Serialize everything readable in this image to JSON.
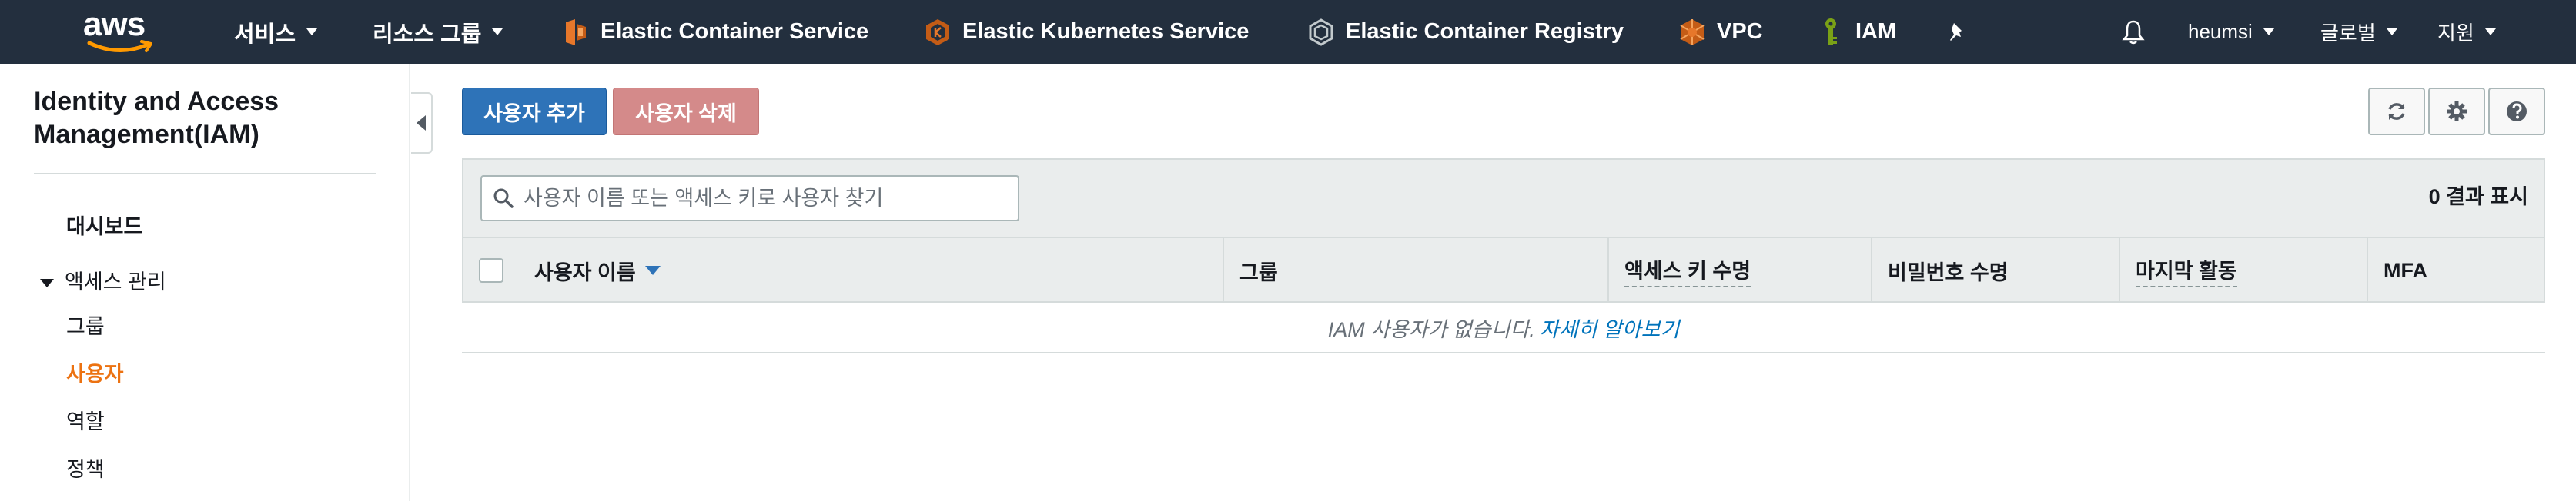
{
  "topnav": {
    "logo_text": "aws",
    "services_label": "서비스",
    "resource_groups_label": "리소스 그룹",
    "pinned": [
      {
        "label": "Elastic Container Service",
        "icon": "ecs-icon",
        "color": "#e7772a"
      },
      {
        "label": "Elastic Kubernetes Service",
        "icon": "eks-icon",
        "color": "#e7772a"
      },
      {
        "label": "Elastic Container Registry",
        "icon": "ecr-icon",
        "color": "#aab7b8"
      },
      {
        "label": "VPC",
        "icon": "vpc-icon",
        "color": "#e7772a"
      },
      {
        "label": "IAM",
        "icon": "iam-icon",
        "color": "#7aa116"
      }
    ],
    "pin_icon": "pin-icon",
    "bell_icon": "bell-icon",
    "account_label": "heumsi",
    "region_label": "글로벌",
    "support_label": "지원"
  },
  "sidebar": {
    "title": "Identity and Access Management(IAM)",
    "items": [
      {
        "label": "대시보드"
      },
      {
        "label": "액세스 관리"
      },
      {
        "label": "그룹"
      },
      {
        "label": "사용자"
      },
      {
        "label": "역할"
      },
      {
        "label": "정책"
      }
    ]
  },
  "toolbar": {
    "add_user_label": "사용자 추가",
    "delete_user_label": "사용자 삭제"
  },
  "search": {
    "placeholder": "사용자 이름 또는 액세스 키로 사용자 찾기"
  },
  "results": {
    "count_label": "0 결과 표시"
  },
  "table": {
    "columns": [
      "사용자 이름",
      "그룹",
      "액세스 키 수명",
      "비밀번호 수명",
      "마지막 활동",
      "MFA"
    ],
    "empty_text": "IAM 사용자가 없습니다.",
    "learn_more_link": "자세히 알아보기"
  },
  "colors": {
    "nav_bg": "#232f3e",
    "primary": "#2e73b8",
    "danger_disabled": "#d48a8a",
    "active_nav": "#ec7211",
    "link": "#0073bb"
  }
}
